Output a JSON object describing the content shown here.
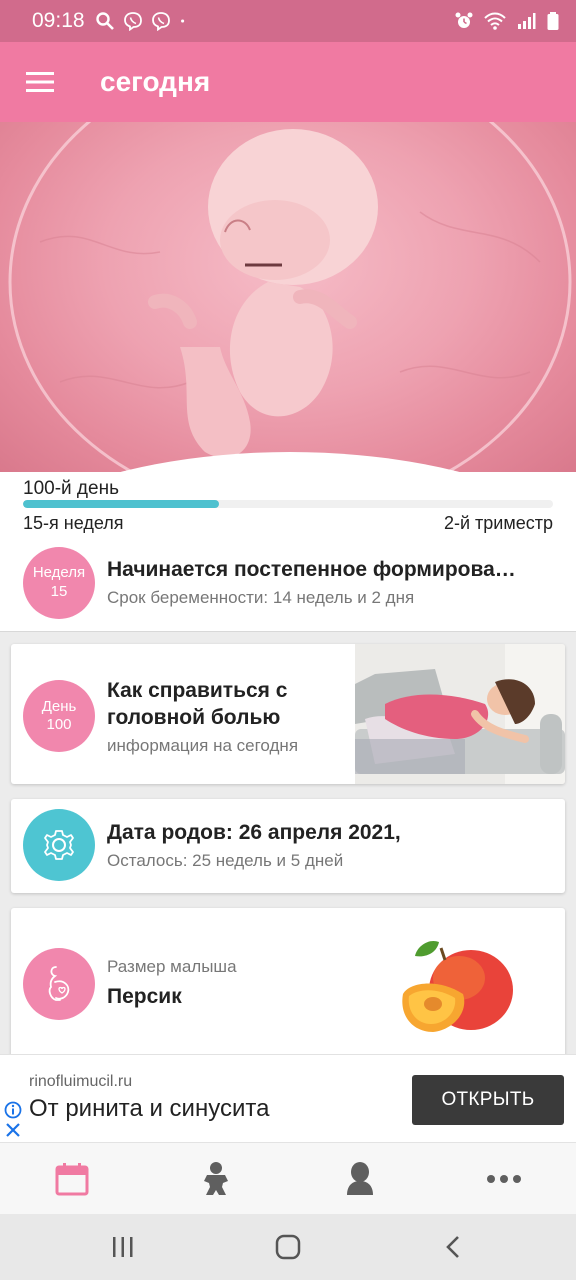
{
  "status_bar": {
    "time": "09:18",
    "icons_left": [
      "search-icon",
      "viber-icon",
      "viber-icon",
      "dot-icon"
    ],
    "icons_right": [
      "alarm-icon",
      "wifi-icon",
      "signal-icon",
      "battery-icon"
    ]
  },
  "app_bar": {
    "title": "сегодня",
    "menu_icon": "hamburger-menu-icon"
  },
  "progress": {
    "day_label": "100-й день",
    "fraction": 0.37,
    "week_label": "15-я неделя",
    "trimester_label": "2-й триместр"
  },
  "week_summary": {
    "circle_top": "Неделя",
    "circle_num": "15",
    "title": "Начинается постепенное формирова…",
    "subtitle": "Срок беременности: 14 недель и 2 дня"
  },
  "day_card": {
    "circle_top": "День",
    "circle_num": "100",
    "title_line1": "Как справиться с",
    "title_line2": "головной болью",
    "subtitle": "информация на сегодня"
  },
  "due_card": {
    "icon": "gear-icon",
    "title": "Дата родов: 26 апреля 2021,",
    "subtitle": "Осталось: 25 недель и 5 дней"
  },
  "size_card": {
    "icon": "pregnancy-icon",
    "label": "Размер малыша",
    "value": "Персик"
  },
  "ad": {
    "domain": "rinofluimucil.ru",
    "title": "От ринита и синусита",
    "button": "ОТКРЫТЬ"
  },
  "bottom_nav": [
    "calendar-icon",
    "baby-icon",
    "mother-icon",
    "more-icon"
  ],
  "colors": {
    "status_bar": "#d16b8c",
    "app_bar": "#f07aa2",
    "accent_pink": "#f187ad",
    "accent_teal": "#4ec5d2",
    "progress_fill": "#4ec1cf"
  }
}
